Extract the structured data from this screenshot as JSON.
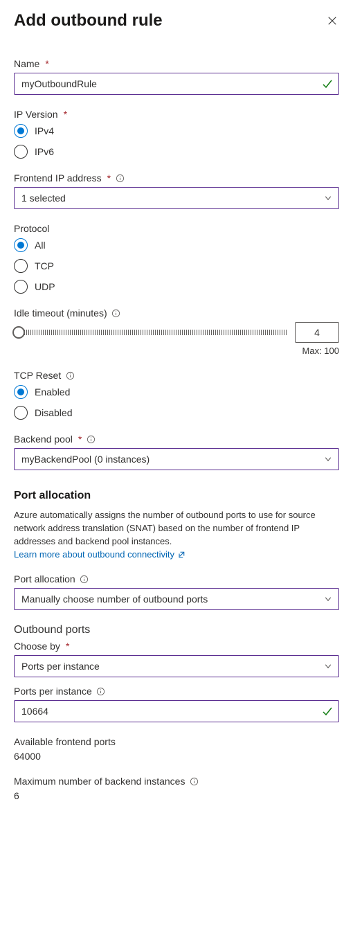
{
  "header": {
    "title": "Add outbound rule"
  },
  "name": {
    "label": "Name",
    "value": "myOutboundRule"
  },
  "ipversion": {
    "label": "IP Version",
    "options": [
      "IPv4",
      "IPv6"
    ],
    "selected": "IPv4"
  },
  "frontendip": {
    "label": "Frontend IP address",
    "value": "1 selected"
  },
  "protocol": {
    "label": "Protocol",
    "options": [
      "All",
      "TCP",
      "UDP"
    ],
    "selected": "All"
  },
  "idletimeout": {
    "label": "Idle timeout (minutes)",
    "value": "4",
    "max_label": "Max: 100"
  },
  "tcpreset": {
    "label": "TCP Reset",
    "options": [
      "Enabled",
      "Disabled"
    ],
    "selected": "Enabled"
  },
  "backendpool": {
    "label": "Backend pool",
    "value": "myBackendPool (0 instances)"
  },
  "portalloc": {
    "section_title": "Port allocation",
    "description": "Azure automatically assigns the number of outbound ports to use for source network address translation (SNAT) based on the number of frontend IP addresses and backend pool instances.",
    "link_text": "Learn more about outbound connectivity",
    "label": "Port allocation",
    "value": "Manually choose number of outbound ports"
  },
  "outboundports": {
    "title": "Outbound ports",
    "chooseby": {
      "label": "Choose by",
      "value": "Ports per instance"
    },
    "pperinst": {
      "label": "Ports per instance",
      "value": "10664"
    },
    "available": {
      "label": "Available frontend ports",
      "value": "64000"
    },
    "maxinst": {
      "label": "Maximum number of backend instances",
      "value": "6"
    }
  }
}
